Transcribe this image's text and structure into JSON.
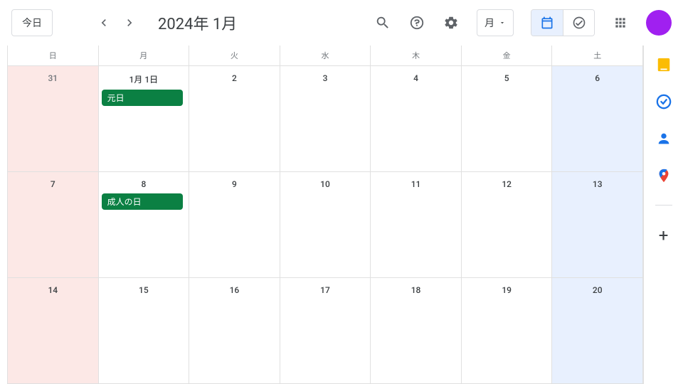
{
  "header": {
    "today_label": "今日",
    "title": "2024年 1月",
    "view_label": "月"
  },
  "weekdays": [
    "日",
    "月",
    "火",
    "水",
    "木",
    "金",
    "土"
  ],
  "rows": [
    [
      {
        "date": "31",
        "sunday": true,
        "muted": true
      },
      {
        "date": "1月 1日",
        "event": "元日"
      },
      {
        "date": "2"
      },
      {
        "date": "3"
      },
      {
        "date": "4"
      },
      {
        "date": "5"
      },
      {
        "date": "6",
        "saturday": true
      }
    ],
    [
      {
        "date": "7",
        "sunday": true
      },
      {
        "date": "8",
        "event": "成人の日"
      },
      {
        "date": "9"
      },
      {
        "date": "10"
      },
      {
        "date": "11"
      },
      {
        "date": "12"
      },
      {
        "date": "13",
        "saturday": true
      }
    ],
    [
      {
        "date": "14",
        "sunday": true
      },
      {
        "date": "15"
      },
      {
        "date": "16"
      },
      {
        "date": "17"
      },
      {
        "date": "18"
      },
      {
        "date": "19"
      },
      {
        "date": "20",
        "saturday": true
      }
    ]
  ]
}
